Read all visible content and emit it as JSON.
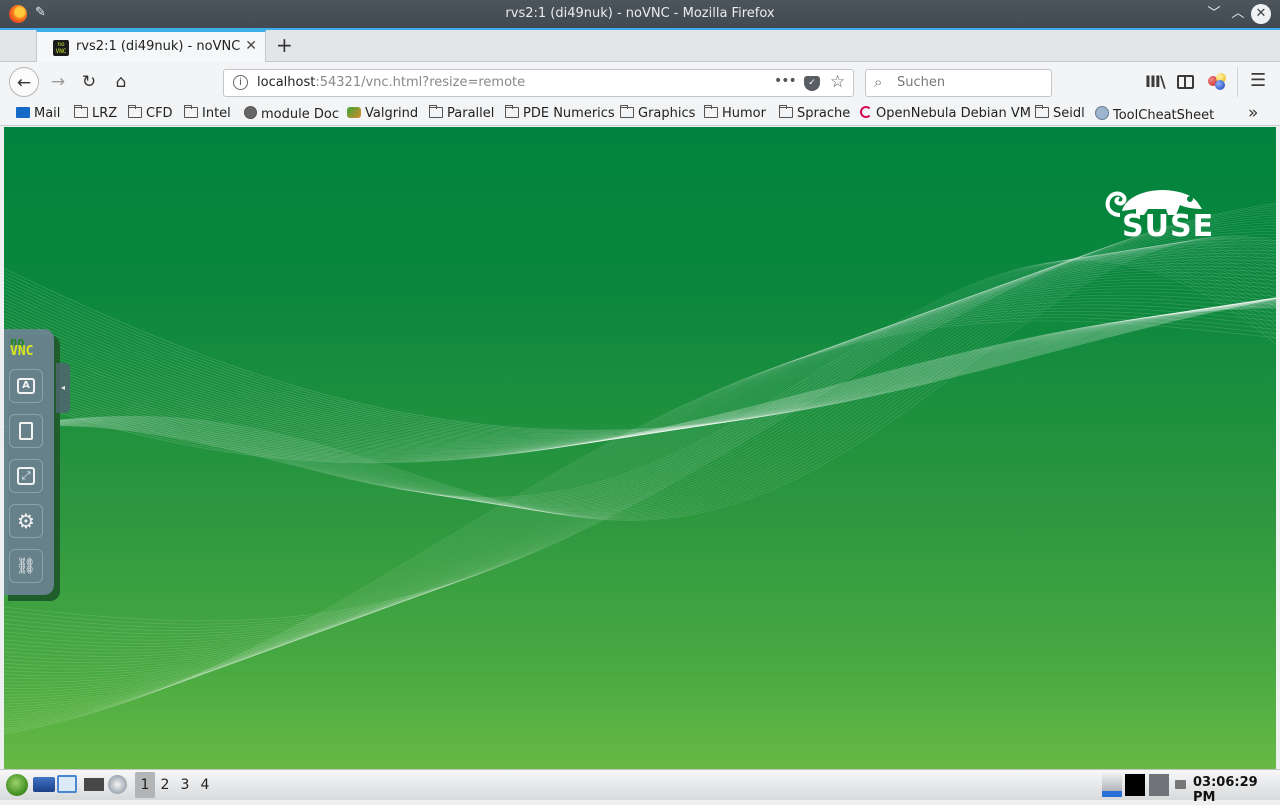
{
  "window": {
    "title": "rvs2:1 (di49nuk) - noVNC - Mozilla Firefox",
    "controls": {
      "minimize": "﹀",
      "maximize": "︿",
      "close": "✕"
    }
  },
  "tabs": [
    {
      "label": "rvs2:1 (di49nuk) - noVNC",
      "favicon": "noVNC",
      "active": true
    }
  ],
  "tab_close": "✕",
  "new_tab": "+",
  "nav": {
    "back": "←",
    "forward": "→",
    "reload": "↻",
    "home": "⌂",
    "url_host": "localhost",
    "url_rest": ":54321/vnc.html?resize=remote",
    "page_actions": "•••",
    "pocket": "✓",
    "bookmark_star": "☆",
    "info": "i"
  },
  "search": {
    "placeholder": "Suchen",
    "value": "",
    "icon": "⌕"
  },
  "toolbar": {
    "library": "III\\",
    "menu": "☰"
  },
  "bookmarks": [
    {
      "label": "Mail",
      "icon": "mail"
    },
    {
      "label": "LRZ",
      "icon": "folder"
    },
    {
      "label": "CFD",
      "icon": "folder"
    },
    {
      "label": "Intel",
      "icon": "folder"
    },
    {
      "label": "module Doc",
      "icon": "globe"
    },
    {
      "label": "Valgrind",
      "icon": "valgrind"
    },
    {
      "label": "Parallel",
      "icon": "folder"
    },
    {
      "label": "PDE Numerics",
      "icon": "folder"
    },
    {
      "label": "Graphics",
      "icon": "folder"
    },
    {
      "label": "Humor",
      "icon": "folder"
    },
    {
      "label": "Sprache",
      "icon": "folder"
    },
    {
      "label": "OpenNebula Debian VM",
      "icon": "debian"
    },
    {
      "label": "Seidl",
      "icon": "folder"
    },
    {
      "label": "ToolCheatSheet",
      "icon": "tool"
    }
  ],
  "bookmarks_overflow": "»",
  "remote_desktop": {
    "logo_text": "SUSE",
    "colors": {
      "top": "#00833d",
      "bottom": "#67b944"
    }
  },
  "novnc": {
    "logo_no": "no",
    "logo_vnc": "VNC",
    "buttons": [
      {
        "name": "extra-keys",
        "glyph": "A"
      },
      {
        "name": "clipboard",
        "glyph": "📋"
      },
      {
        "name": "fullscreen",
        "glyph": "⤢"
      },
      {
        "name": "settings",
        "glyph": "⚙"
      },
      {
        "name": "disconnect",
        "glyph": "⛓"
      }
    ],
    "handle_arrow": "◂"
  },
  "taskbar": {
    "workspaces": [
      "1",
      "2",
      "3",
      "4"
    ],
    "active_workspace": "1",
    "clock": "03:06:29 PM"
  }
}
